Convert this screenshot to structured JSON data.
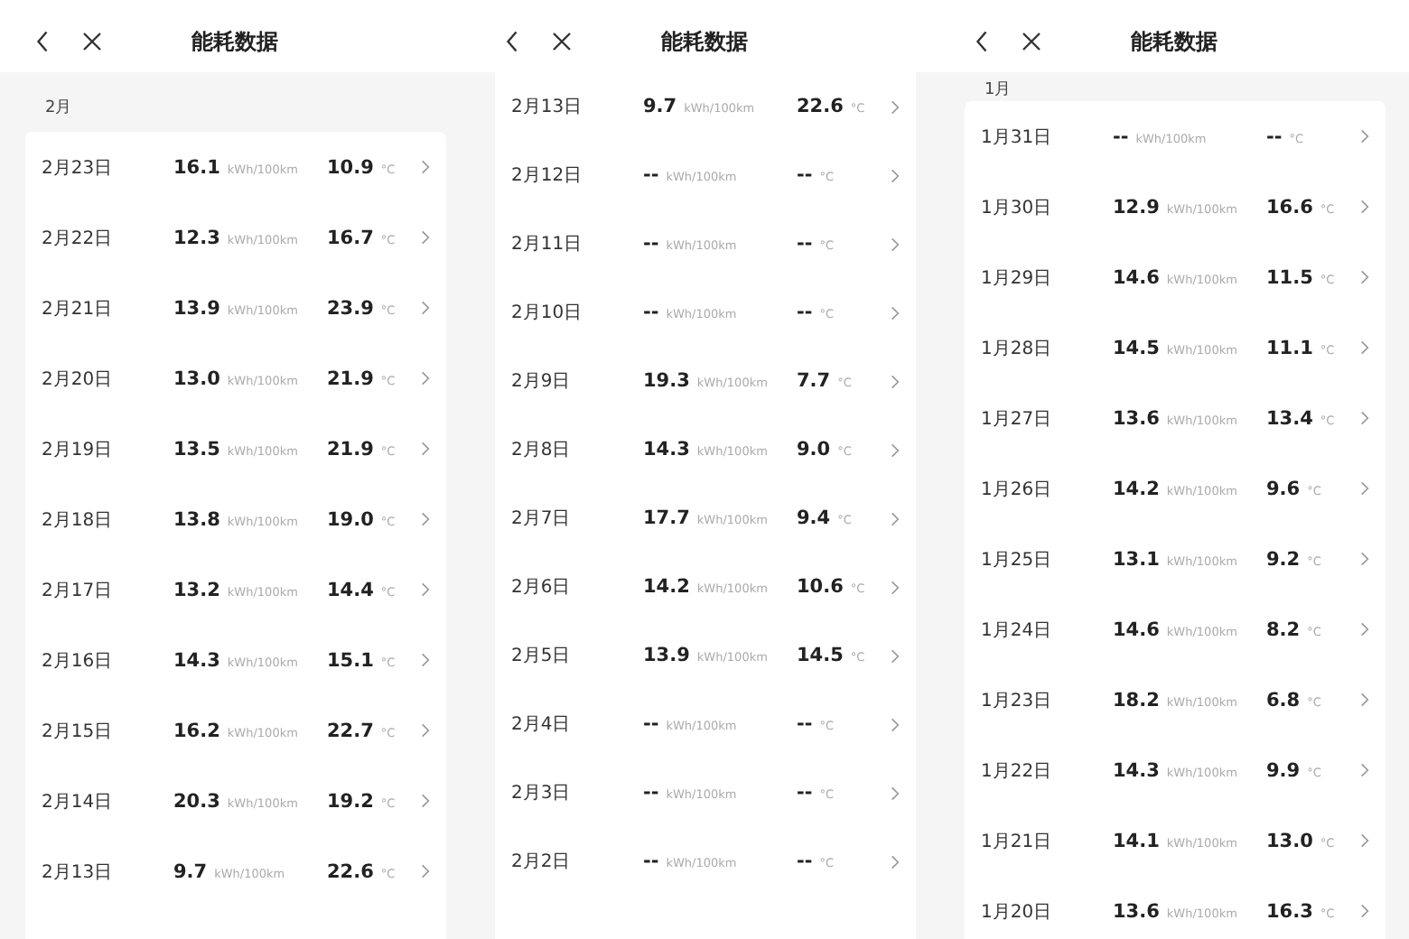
{
  "panels": [
    {
      "title": "能耗数据",
      "month": "2月",
      "rows": [
        {
          "date": "2月23日",
          "energy": "16.1",
          "energy_unit": "kWh/100km",
          "temp": "10.9",
          "temp_unit": "°C"
        },
        {
          "date": "2月22日",
          "energy": "12.3",
          "energy_unit": "kWh/100km",
          "temp": "16.7",
          "temp_unit": "°C"
        },
        {
          "date": "2月21日",
          "energy": "13.9",
          "energy_unit": "kWh/100km",
          "temp": "23.9",
          "temp_unit": "°C"
        },
        {
          "date": "2月20日",
          "energy": "13.0",
          "energy_unit": "kWh/100km",
          "temp": "21.9",
          "temp_unit": "°C"
        },
        {
          "date": "2月19日",
          "energy": "13.5",
          "energy_unit": "kWh/100km",
          "temp": "21.9",
          "temp_unit": "°C"
        },
        {
          "date": "2月18日",
          "energy": "13.8",
          "energy_unit": "kWh/100km",
          "temp": "19.0",
          "temp_unit": "°C"
        },
        {
          "date": "2月17日",
          "energy": "13.2",
          "energy_unit": "kWh/100km",
          "temp": "14.4",
          "temp_unit": "°C"
        },
        {
          "date": "2月16日",
          "energy": "14.3",
          "energy_unit": "kWh/100km",
          "temp": "15.1",
          "temp_unit": "°C"
        },
        {
          "date": "2月15日",
          "energy": "16.2",
          "energy_unit": "kWh/100km",
          "temp": "22.7",
          "temp_unit": "°C"
        },
        {
          "date": "2月14日",
          "energy": "20.3",
          "energy_unit": "kWh/100km",
          "temp": "19.2",
          "temp_unit": "°C"
        },
        {
          "date": "2月13日",
          "energy": "9.7",
          "energy_unit": "kWh/100km",
          "temp": "22.6",
          "temp_unit": "°C"
        }
      ]
    },
    {
      "title": "能耗数据",
      "rows": [
        {
          "date": "2月13日",
          "energy": "9.7",
          "energy_unit": "kWh/100km",
          "temp": "22.6",
          "temp_unit": "°C"
        },
        {
          "date": "2月12日",
          "energy": "--",
          "energy_unit": "kWh/100km",
          "temp": "--",
          "temp_unit": "°C"
        },
        {
          "date": "2月11日",
          "energy": "--",
          "energy_unit": "kWh/100km",
          "temp": "--",
          "temp_unit": "°C"
        },
        {
          "date": "2月10日",
          "energy": "--",
          "energy_unit": "kWh/100km",
          "temp": "--",
          "temp_unit": "°C"
        },
        {
          "date": "2月9日",
          "energy": "19.3",
          "energy_unit": "kWh/100km",
          "temp": "7.7",
          "temp_unit": "°C"
        },
        {
          "date": "2月8日",
          "energy": "14.3",
          "energy_unit": "kWh/100km",
          "temp": "9.0",
          "temp_unit": "°C"
        },
        {
          "date": "2月7日",
          "energy": "17.7",
          "energy_unit": "kWh/100km",
          "temp": "9.4",
          "temp_unit": "°C"
        },
        {
          "date": "2月6日",
          "energy": "14.2",
          "energy_unit": "kWh/100km",
          "temp": "10.6",
          "temp_unit": "°C"
        },
        {
          "date": "2月5日",
          "energy": "13.9",
          "energy_unit": "kWh/100km",
          "temp": "14.5",
          "temp_unit": "°C"
        },
        {
          "date": "2月4日",
          "energy": "--",
          "energy_unit": "kWh/100km",
          "temp": "--",
          "temp_unit": "°C"
        },
        {
          "date": "2月3日",
          "energy": "--",
          "energy_unit": "kWh/100km",
          "temp": "--",
          "temp_unit": "°C"
        },
        {
          "date": "2月2日",
          "energy": "--",
          "energy_unit": "kWh/100km",
          "temp": "--",
          "temp_unit": "°C"
        }
      ]
    },
    {
      "title": "能耗数据",
      "month": "1月",
      "rows": [
        {
          "date": "1月31日",
          "energy": "--",
          "energy_unit": "kWh/100km",
          "temp": "--",
          "temp_unit": "°C"
        },
        {
          "date": "1月30日",
          "energy": "12.9",
          "energy_unit": "kWh/100km",
          "temp": "16.6",
          "temp_unit": "°C"
        },
        {
          "date": "1月29日",
          "energy": "14.6",
          "energy_unit": "kWh/100km",
          "temp": "11.5",
          "temp_unit": "°C"
        },
        {
          "date": "1月28日",
          "energy": "14.5",
          "energy_unit": "kWh/100km",
          "temp": "11.1",
          "temp_unit": "°C"
        },
        {
          "date": "1月27日",
          "energy": "13.6",
          "energy_unit": "kWh/100km",
          "temp": "13.4",
          "temp_unit": "°C"
        },
        {
          "date": "1月26日",
          "energy": "14.2",
          "energy_unit": "kWh/100km",
          "temp": "9.6",
          "temp_unit": "°C"
        },
        {
          "date": "1月25日",
          "energy": "13.1",
          "energy_unit": "kWh/100km",
          "temp": "9.2",
          "temp_unit": "°C"
        },
        {
          "date": "1月24日",
          "energy": "14.6",
          "energy_unit": "kWh/100km",
          "temp": "8.2",
          "temp_unit": "°C"
        },
        {
          "date": "1月23日",
          "energy": "18.2",
          "energy_unit": "kWh/100km",
          "temp": "6.8",
          "temp_unit": "°C"
        },
        {
          "date": "1月22日",
          "energy": "14.3",
          "energy_unit": "kWh/100km",
          "temp": "9.9",
          "temp_unit": "°C"
        },
        {
          "date": "1月21日",
          "energy": "14.1",
          "energy_unit": "kWh/100km",
          "temp": "13.0",
          "temp_unit": "°C"
        },
        {
          "date": "1月20日",
          "energy": "13.6",
          "energy_unit": "kWh/100km",
          "temp": "16.3",
          "temp_unit": "°C"
        }
      ]
    }
  ]
}
